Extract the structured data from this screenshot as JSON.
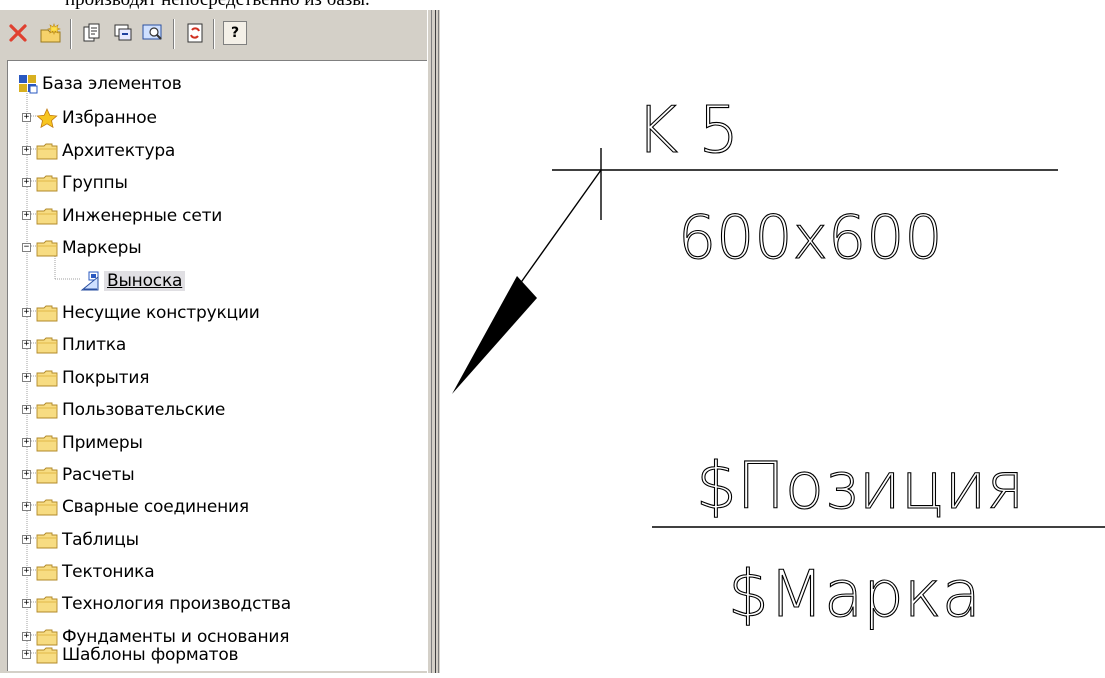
{
  "caption": "производят непосредственно из базы.",
  "toolbar": {
    "buttons": [
      {
        "icon": "delete-icon"
      },
      {
        "icon": "new-folder-icon"
      },
      {
        "icon": "properties-icon"
      },
      {
        "icon": "insert-icon"
      },
      {
        "icon": "preview-icon"
      },
      {
        "icon": "refresh-icon"
      },
      {
        "icon": "help-icon",
        "label": "?"
      }
    ]
  },
  "tree": {
    "root": "База элементов",
    "items": [
      {
        "label": "Избранное",
        "icon": "star-icon",
        "expanded": false
      },
      {
        "label": "Архитектура",
        "icon": "folder-icon",
        "expanded": false
      },
      {
        "label": "Группы",
        "icon": "folder-icon",
        "expanded": false
      },
      {
        "label": "Инженерные сети",
        "icon": "folder-icon",
        "expanded": false
      },
      {
        "label": "Маркеры",
        "icon": "folder-icon",
        "expanded": true
      },
      {
        "label": "Выноска",
        "icon": "leader-element-icon",
        "selected": true
      },
      {
        "label": "Несущие конструкции",
        "icon": "folder-icon",
        "expanded": false
      },
      {
        "label": "Плитка",
        "icon": "folder-icon",
        "expanded": false
      },
      {
        "label": "Покрытия",
        "icon": "folder-icon",
        "expanded": false
      },
      {
        "label": "Пользовательские",
        "icon": "folder-icon",
        "expanded": false
      },
      {
        "label": "Примеры",
        "icon": "folder-icon",
        "expanded": false
      },
      {
        "label": "Расчеты",
        "icon": "folder-icon",
        "expanded": false
      },
      {
        "label": "Сварные соединения",
        "icon": "folder-icon",
        "expanded": false
      },
      {
        "label": "Таблицы",
        "icon": "folder-icon",
        "expanded": false
      },
      {
        "label": "Тектоника",
        "icon": "folder-icon",
        "expanded": false
      },
      {
        "label": "Технология производства",
        "icon": "folder-icon",
        "expanded": false
      },
      {
        "label": "Фундаменты и основания",
        "icon": "folder-icon",
        "expanded": false
      },
      {
        "label": "Шаблоны форматов",
        "icon": "folder-icon",
        "expanded": false
      }
    ]
  },
  "drawing": {
    "marker_top": "K 5",
    "marker_bottom": "600x600",
    "template_top": "$Позиция",
    "template_bottom": "$Марка"
  }
}
